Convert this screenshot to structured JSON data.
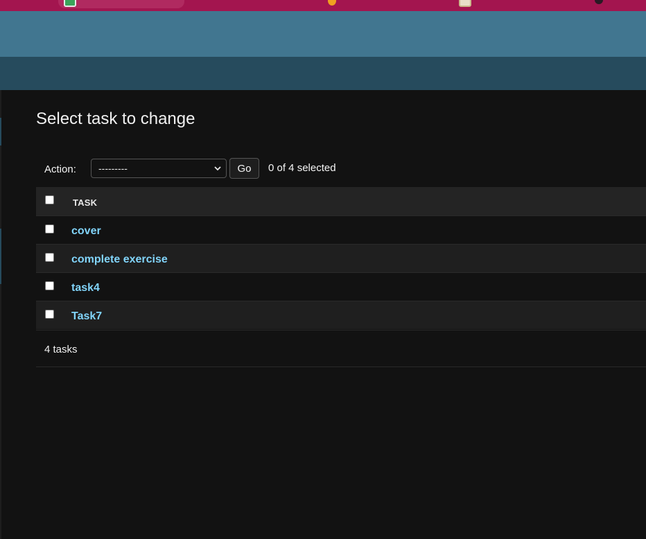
{
  "colors": {
    "browser_bar": "#a3154f",
    "header": "#417690",
    "breadcrumbs": "#264b5d",
    "background": "#121212",
    "link": "#81d4fa"
  },
  "page": {
    "title": "Select task to change"
  },
  "actions": {
    "label": "Action:",
    "selected_option": "---------",
    "go_label": "Go",
    "counter": "0 of 4 selected"
  },
  "table": {
    "column_header": "TASK",
    "rows": [
      {
        "name": "cover"
      },
      {
        "name": "complete exercise"
      },
      {
        "name": "task4"
      },
      {
        "name": "Task7"
      }
    ]
  },
  "paginator": {
    "count_text": "4 tasks"
  }
}
